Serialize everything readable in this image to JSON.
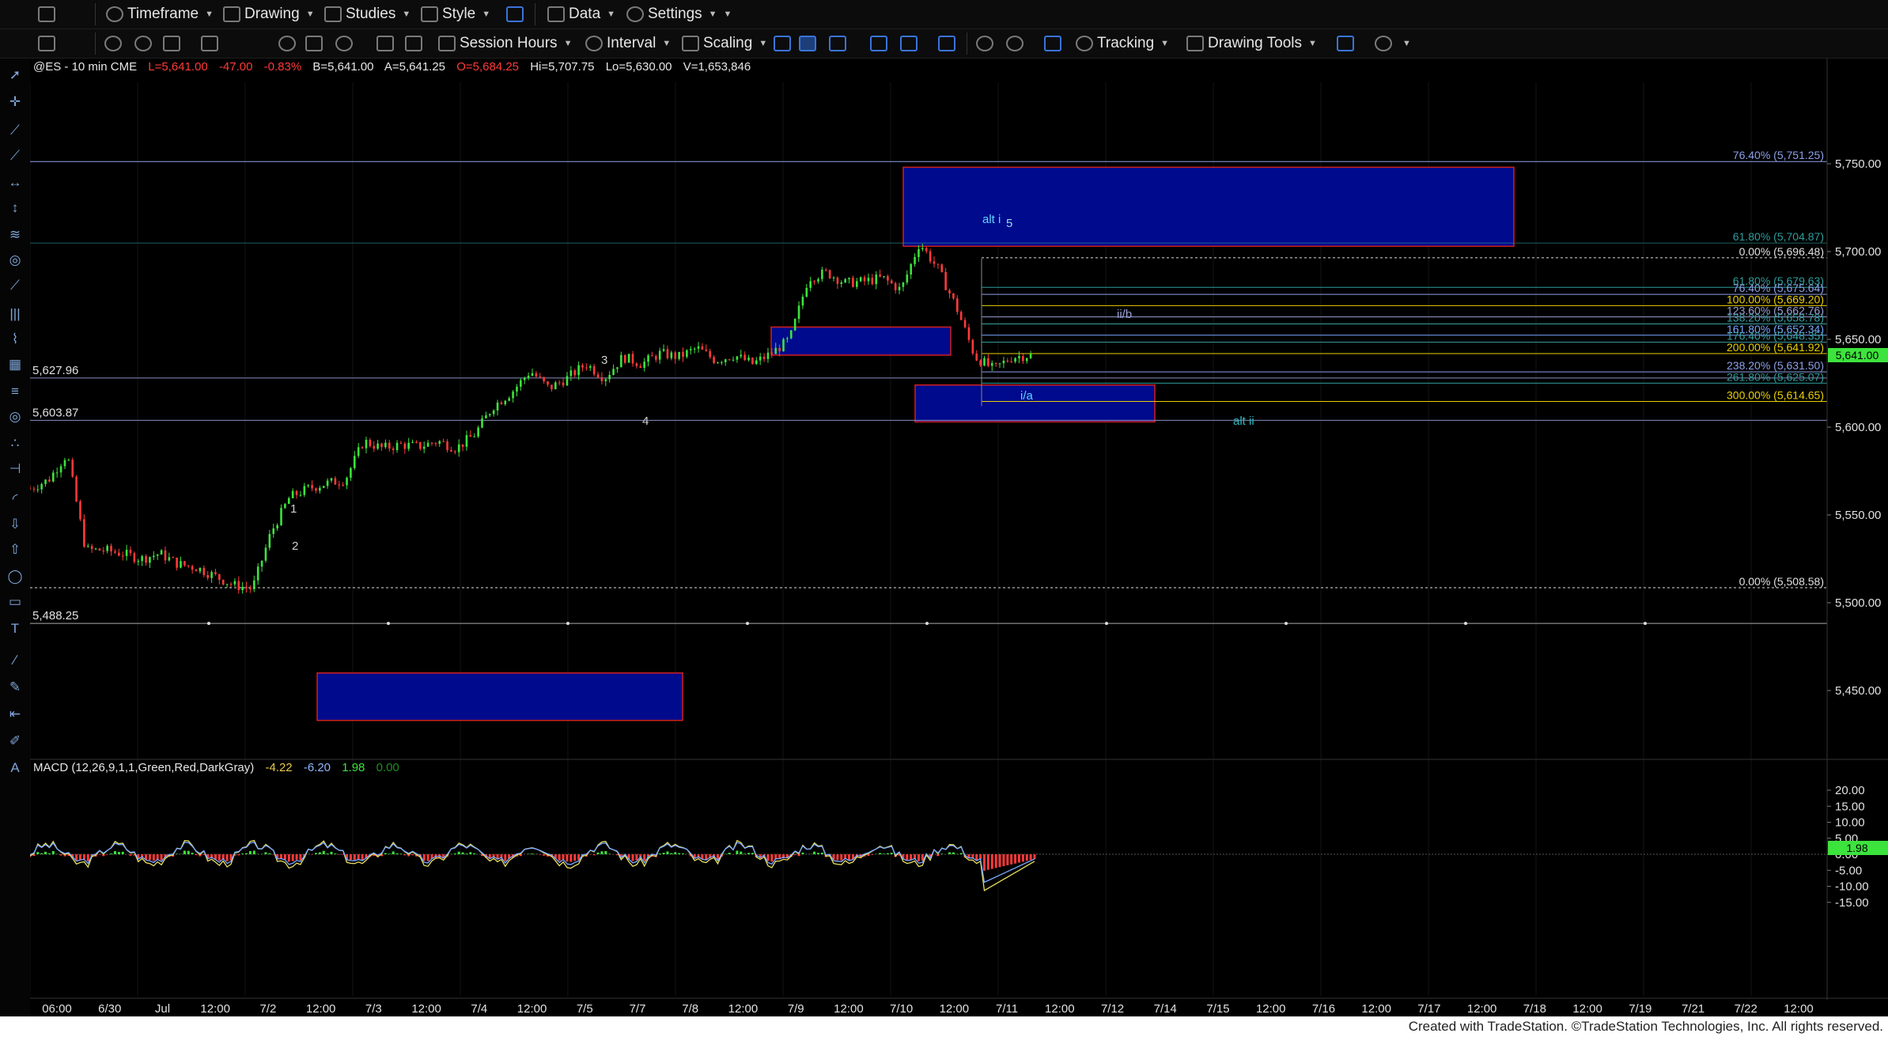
{
  "toolbar_top": {
    "items": [
      {
        "id": "timeframe",
        "label": "Timeframe",
        "icon": "clock-icon"
      },
      {
        "id": "drawing",
        "label": "Drawing",
        "icon": "pencil-icon"
      },
      {
        "id": "studies",
        "label": "Studies",
        "icon": "studies-icon"
      },
      {
        "id": "style",
        "label": "Style",
        "icon": "style-icon"
      },
      {
        "id": "data",
        "label": "Data",
        "icon": "data-icon"
      },
      {
        "id": "settings",
        "label": "Settings",
        "icon": "gear-icon"
      }
    ]
  },
  "toolbar_second": {
    "items": [
      {
        "id": "session_hours",
        "label": "Session Hours",
        "icon": "session-icon"
      },
      {
        "id": "interval",
        "label": "Interval",
        "icon": "interval-icon"
      },
      {
        "id": "scaling",
        "label": "Scaling",
        "icon": "scaling-icon"
      },
      {
        "id": "tracking",
        "label": "Tracking",
        "icon": "tracking-icon"
      },
      {
        "id": "drawing_tools",
        "label": "Drawing Tools",
        "icon": "drawing-tools-icon"
      }
    ]
  },
  "symbol_header": {
    "symbol": "@ES - 10 min  CME",
    "last": "L=5,641.00",
    "change": "-47.00",
    "pct": "-0.83%",
    "bid": "B=5,641.00",
    "ask": "A=5,641.25",
    "open": "O=5,684.25",
    "high": "Hi=5,707.75",
    "low": "Lo=5,630.00",
    "volume": "V=1,653,846"
  },
  "chart_data": {
    "type": "candlestick",
    "price_axis": {
      "labels": [
        "5,750.00",
        "5,700.00",
        "5,650.00",
        "5,600.00",
        "5,550.00",
        "5,500.00",
        "5,450.00"
      ],
      "values": [
        5750,
        5700,
        5650,
        5600,
        5550,
        5500,
        5450
      ],
      "current": "5,641.00"
    },
    "time_axis": {
      "labels": [
        "06:00",
        "6/30",
        "Jul",
        "12:00",
        "7/2",
        "12:00",
        "7/3",
        "12:00",
        "7/4",
        "12:00",
        "7/5",
        "7/7",
        "7/8",
        "12:00",
        "7/9",
        "12:00",
        "7/10",
        "12:00",
        "7/11",
        "12:00",
        "7/12",
        "7/14",
        "7/15",
        "12:00",
        "7/16",
        "12:00",
        "7/17",
        "12:00",
        "7/18",
        "12:00",
        "7/19",
        "7/21",
        "7/22",
        "12:00"
      ]
    },
    "price_path": [
      5565,
      5570,
      5585,
      5530,
      5530,
      5528,
      5525,
      5528,
      5522,
      5520,
      5515,
      5510,
      5508,
      5540,
      5560,
      5565,
      5568,
      5570,
      5592,
      5588,
      5590,
      5589,
      5592,
      5588,
      5596,
      5612,
      5620,
      5632,
      5622,
      5628,
      5636,
      5628,
      5640,
      5636,
      5642,
      5640,
      5645,
      5638,
      5641,
      5636,
      5642,
      5650,
      5685,
      5688,
      5682,
      5683,
      5685,
      5678,
      5705,
      5690,
      5668,
      5640,
      5633,
      5640,
      5641
    ],
    "horizontal_levels": [
      {
        "label": "5,627.96",
        "value": 5627.96
      },
      {
        "label": "5,603.87",
        "value": 5603.87
      },
      {
        "label": "5,488.25",
        "value": 5488.25
      }
    ],
    "fib_levels": [
      {
        "label": "76.40% (5,751.25)",
        "value": 5751.25,
        "color": "#8da0e8"
      },
      {
        "label": "61.80% (5,704.87)",
        "value": 5704.87,
        "color": "#2e9c9c"
      },
      {
        "label": "0.00% (5,696.48)",
        "value": 5696.48,
        "color": "#e0e0e0"
      },
      {
        "label": "61.80% (5,679.63)",
        "value": 5679.63,
        "color": "#2e9c9c"
      },
      {
        "label": "76.40% (5,675.64)",
        "value": 5675.64,
        "color": "#8da0e8"
      },
      {
        "label": "100.00% (5,669.20)",
        "value": 5669.2,
        "color": "#e8d000"
      },
      {
        "label": "123.60% (5,662.76)",
        "value": 5662.76,
        "color": "#9aa0d8"
      },
      {
        "label": "138.20% (5,658.78)",
        "value": 5658.78,
        "color": "#3aa0a0"
      },
      {
        "label": "161.80% (5,652.34)",
        "value": 5652.34,
        "color": "#7aa8ff"
      },
      {
        "label": "176.40% (5,648.35)",
        "value": 5648.35,
        "color": "#3aa0a0"
      },
      {
        "label": "200.00% (5,641.92)",
        "value": 5641.92,
        "color": "#e8d000"
      },
      {
        "label": "238.20% (5,631.50)",
        "value": 5631.5,
        "color": "#8da0e8"
      },
      {
        "label": "261.80% (5,625.07)",
        "value": 5625.07,
        "color": "#2e9c9c"
      },
      {
        "label": "300.00% (5,614.65)",
        "value": 5614.65,
        "color": "#e8d000"
      },
      {
        "label": "0.00% (5,508.58)",
        "value": 5508.58,
        "color": "#e0e0e0"
      }
    ],
    "wave_labels": [
      {
        "text": "1",
        "color": "#cfcfcf"
      },
      {
        "text": "2",
        "color": "#cfcfcf"
      },
      {
        "text": "3",
        "color": "#cfcfcf"
      },
      {
        "text": "4",
        "color": "#cfcfcf"
      },
      {
        "text": "5",
        "color": "#9ad8e8"
      },
      {
        "text": "alt i",
        "color": "#5fd4ff"
      },
      {
        "text": "ii/b",
        "color": "#9aa0d8"
      },
      {
        "text": "i/a",
        "color": "#5fd4ff"
      },
      {
        "text": "alt ii",
        "color": "#2fb8c0"
      }
    ],
    "macd": {
      "title": "MACD (12,26,9,1,1,Green,Red,DarkGray)",
      "values": [
        "-4.22",
        "-6.20",
        "1.98",
        "0.00"
      ],
      "value_colors": [
        "#e8c84a",
        "#8fb7ff",
        "#3de33d",
        "#1e8f1e"
      ],
      "axis_labels": [
        "20.00",
        "15.00",
        "10.00",
        "5.00",
        "0.00",
        "-5.00",
        "-10.00",
        "-15.00"
      ],
      "axis_values": [
        20,
        15,
        10,
        5,
        0,
        -5,
        -10,
        -15
      ],
      "current": "1.98"
    }
  },
  "footer": {
    "text": "Created with TradeStation. ©TradeStation Technologies, Inc. All rights reserved."
  },
  "colors": {
    "up": "#3de33d",
    "down": "#ff3a3a",
    "zone_fill": "#000a8c",
    "zone_border": "#d02020",
    "accent": "#3a74d8"
  }
}
